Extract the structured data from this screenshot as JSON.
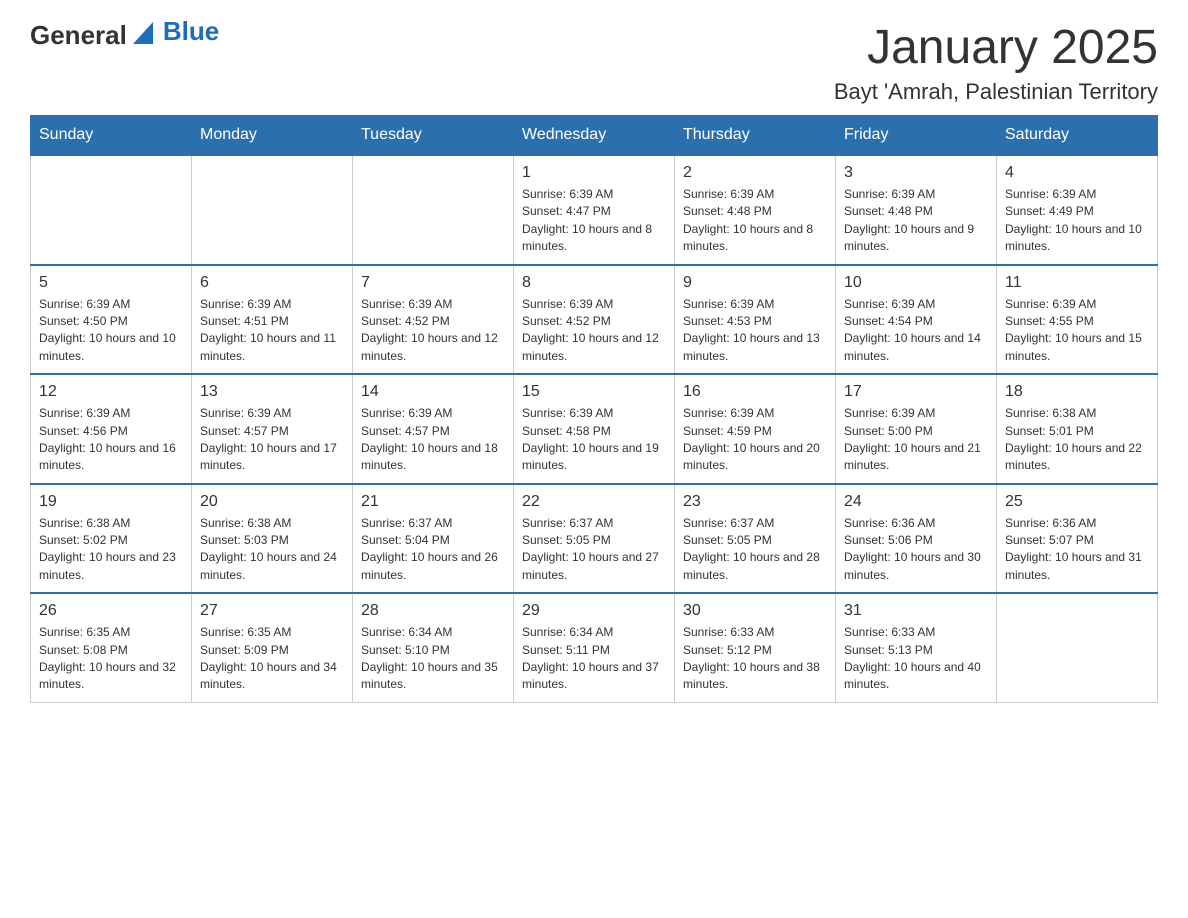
{
  "header": {
    "logo": {
      "general": "General",
      "blue": "Blue"
    },
    "month": "January 2025",
    "location": "Bayt 'Amrah, Palestinian Territory"
  },
  "weekdays": [
    "Sunday",
    "Monday",
    "Tuesday",
    "Wednesday",
    "Thursday",
    "Friday",
    "Saturday"
  ],
  "weeks": [
    [
      {
        "day": "",
        "info": ""
      },
      {
        "day": "",
        "info": ""
      },
      {
        "day": "",
        "info": ""
      },
      {
        "day": "1",
        "info": "Sunrise: 6:39 AM\nSunset: 4:47 PM\nDaylight: 10 hours and 8 minutes."
      },
      {
        "day": "2",
        "info": "Sunrise: 6:39 AM\nSunset: 4:48 PM\nDaylight: 10 hours and 8 minutes."
      },
      {
        "day": "3",
        "info": "Sunrise: 6:39 AM\nSunset: 4:48 PM\nDaylight: 10 hours and 9 minutes."
      },
      {
        "day": "4",
        "info": "Sunrise: 6:39 AM\nSunset: 4:49 PM\nDaylight: 10 hours and 10 minutes."
      }
    ],
    [
      {
        "day": "5",
        "info": "Sunrise: 6:39 AM\nSunset: 4:50 PM\nDaylight: 10 hours and 10 minutes."
      },
      {
        "day": "6",
        "info": "Sunrise: 6:39 AM\nSunset: 4:51 PM\nDaylight: 10 hours and 11 minutes."
      },
      {
        "day": "7",
        "info": "Sunrise: 6:39 AM\nSunset: 4:52 PM\nDaylight: 10 hours and 12 minutes."
      },
      {
        "day": "8",
        "info": "Sunrise: 6:39 AM\nSunset: 4:52 PM\nDaylight: 10 hours and 12 minutes."
      },
      {
        "day": "9",
        "info": "Sunrise: 6:39 AM\nSunset: 4:53 PM\nDaylight: 10 hours and 13 minutes."
      },
      {
        "day": "10",
        "info": "Sunrise: 6:39 AM\nSunset: 4:54 PM\nDaylight: 10 hours and 14 minutes."
      },
      {
        "day": "11",
        "info": "Sunrise: 6:39 AM\nSunset: 4:55 PM\nDaylight: 10 hours and 15 minutes."
      }
    ],
    [
      {
        "day": "12",
        "info": "Sunrise: 6:39 AM\nSunset: 4:56 PM\nDaylight: 10 hours and 16 minutes."
      },
      {
        "day": "13",
        "info": "Sunrise: 6:39 AM\nSunset: 4:57 PM\nDaylight: 10 hours and 17 minutes."
      },
      {
        "day": "14",
        "info": "Sunrise: 6:39 AM\nSunset: 4:57 PM\nDaylight: 10 hours and 18 minutes."
      },
      {
        "day": "15",
        "info": "Sunrise: 6:39 AM\nSunset: 4:58 PM\nDaylight: 10 hours and 19 minutes."
      },
      {
        "day": "16",
        "info": "Sunrise: 6:39 AM\nSunset: 4:59 PM\nDaylight: 10 hours and 20 minutes."
      },
      {
        "day": "17",
        "info": "Sunrise: 6:39 AM\nSunset: 5:00 PM\nDaylight: 10 hours and 21 minutes."
      },
      {
        "day": "18",
        "info": "Sunrise: 6:38 AM\nSunset: 5:01 PM\nDaylight: 10 hours and 22 minutes."
      }
    ],
    [
      {
        "day": "19",
        "info": "Sunrise: 6:38 AM\nSunset: 5:02 PM\nDaylight: 10 hours and 23 minutes."
      },
      {
        "day": "20",
        "info": "Sunrise: 6:38 AM\nSunset: 5:03 PM\nDaylight: 10 hours and 24 minutes."
      },
      {
        "day": "21",
        "info": "Sunrise: 6:37 AM\nSunset: 5:04 PM\nDaylight: 10 hours and 26 minutes."
      },
      {
        "day": "22",
        "info": "Sunrise: 6:37 AM\nSunset: 5:05 PM\nDaylight: 10 hours and 27 minutes."
      },
      {
        "day": "23",
        "info": "Sunrise: 6:37 AM\nSunset: 5:05 PM\nDaylight: 10 hours and 28 minutes."
      },
      {
        "day": "24",
        "info": "Sunrise: 6:36 AM\nSunset: 5:06 PM\nDaylight: 10 hours and 30 minutes."
      },
      {
        "day": "25",
        "info": "Sunrise: 6:36 AM\nSunset: 5:07 PM\nDaylight: 10 hours and 31 minutes."
      }
    ],
    [
      {
        "day": "26",
        "info": "Sunrise: 6:35 AM\nSunset: 5:08 PM\nDaylight: 10 hours and 32 minutes."
      },
      {
        "day": "27",
        "info": "Sunrise: 6:35 AM\nSunset: 5:09 PM\nDaylight: 10 hours and 34 minutes."
      },
      {
        "day": "28",
        "info": "Sunrise: 6:34 AM\nSunset: 5:10 PM\nDaylight: 10 hours and 35 minutes."
      },
      {
        "day": "29",
        "info": "Sunrise: 6:34 AM\nSunset: 5:11 PM\nDaylight: 10 hours and 37 minutes."
      },
      {
        "day": "30",
        "info": "Sunrise: 6:33 AM\nSunset: 5:12 PM\nDaylight: 10 hours and 38 minutes."
      },
      {
        "day": "31",
        "info": "Sunrise: 6:33 AM\nSunset: 5:13 PM\nDaylight: 10 hours and 40 minutes."
      },
      {
        "day": "",
        "info": ""
      }
    ]
  ]
}
